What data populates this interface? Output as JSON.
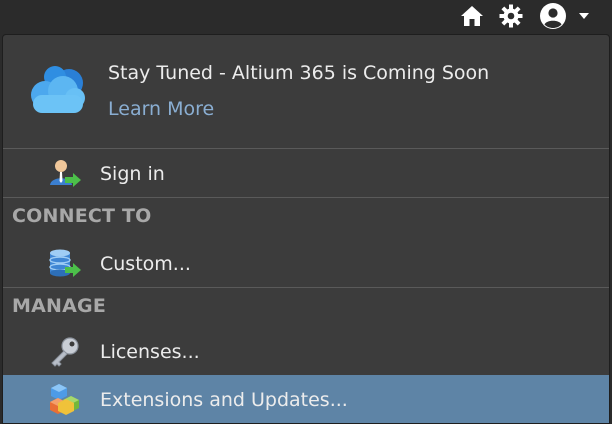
{
  "toolbar": {
    "home_icon": "home-icon",
    "settings_icon": "gear-icon",
    "account_icon": "user-circle-icon",
    "dropdown_icon": "caret-down-icon"
  },
  "promo": {
    "title": "Stay Tuned - Altium 365 is Coming Soon",
    "link": "Learn More",
    "icon": "cloud-icon"
  },
  "menu": {
    "sign_in": "Sign in",
    "connect_header": "CONNECT TO",
    "custom": "Custom...",
    "manage_header": "MANAGE",
    "licenses": "Licenses...",
    "extensions": "Extensions and Updates..."
  },
  "colors": {
    "highlight": "#5e84a6",
    "link": "#8aaed2",
    "background": "#3c3c3c"
  }
}
